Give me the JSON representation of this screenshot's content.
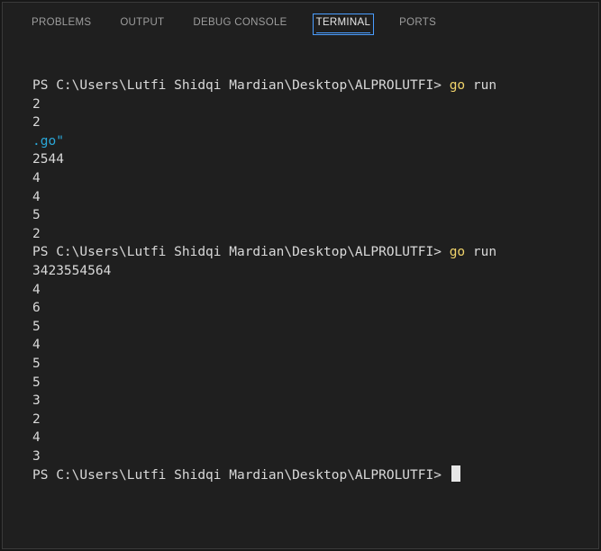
{
  "panel": {
    "tabs": [
      {
        "label": "PROBLEMS"
      },
      {
        "label": "OUTPUT"
      },
      {
        "label": "DEBUG CONSOLE"
      },
      {
        "label": "TERMINAL"
      },
      {
        "label": "PORTS"
      }
    ],
    "active_tab": "TERMINAL"
  },
  "terminal": {
    "prompt": "PS C:\\Users\\Lutfi Shidqi Mardian\\Desktop\\ALPROLUTFI> ",
    "command_go": "go",
    "command_rest": " run",
    "block1": [
      "2",
      "2"
    ],
    "path_fragment": ".go\"",
    "block2": [
      "2544",
      "4",
      "4",
      "5",
      "2"
    ],
    "block3": [
      "3423554564",
      "4",
      "6",
      "5",
      "4",
      "5",
      "5",
      "3",
      "2",
      "4",
      "3"
    ]
  },
  "colors": {
    "background": "#1f1f1f",
    "text": "#d9d9d9",
    "command_highlight": "#f0d36a",
    "path_fragment": "#2aa7d8",
    "active_tab_border": "#4a9dff"
  }
}
